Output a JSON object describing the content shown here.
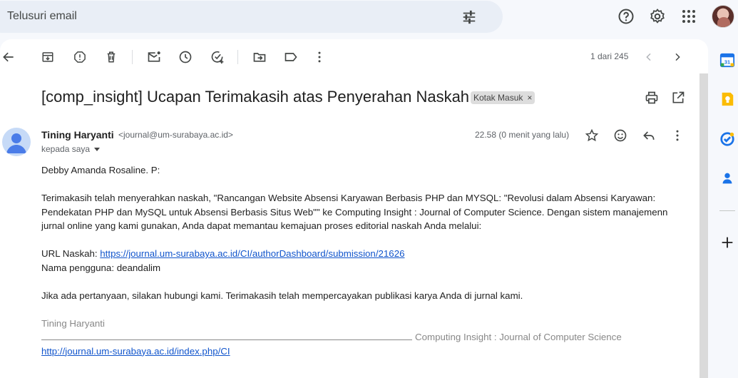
{
  "search": {
    "placeholder": "Telusuri email"
  },
  "toolbar": {
    "pager": "1 dari 245"
  },
  "message": {
    "subject": "[comp_insight] Ucapan Terimakasih atas Penyerahan Naskah",
    "label": "Kotak Masuk",
    "label_close": "×",
    "sender_name": "Tining Haryanti",
    "sender_email": "<journal@um-surabaya.ac.id>",
    "recipient": "kepada saya",
    "timestamp": "22.58 (0 menit yang lalu)",
    "greeting": "Debby Amanda Rosaline. P:",
    "para1": "Terimakasih telah menyerahkan naskah, \"Rancangan Website Absensi Karyawan Berbasis PHP dan MYSQL: \"Revolusi dalam Absensi Karyawan: Pendekatan PHP dan MySQL untuk Absensi Berbasis Situs Web\"\" ke Computing Insight : Journal of Computer Science. Dengan sistem manajemenn jurnal online yang kami gunakan, Anda dapat memantau kemajuan proses editorial naskah Anda melalui:",
    "url_label": "URL Naskah: ",
    "url": "https://journal.um-surabaya.ac.id/CI/authorDashboard/submission/21626",
    "username_line": "Nama pengguna: deandalim",
    "para2": "Jika ada pertanyaan, silakan hubungi kami. Terimakasih telah mempercayakan publikasi karya Anda di jurnal kami.",
    "signature_name": "Tining Haryanti",
    "signature_journal": "Computing Insight : Journal of Computer Science",
    "signature_link": "http://journal.um-surabaya.ac.id/index.php/CI"
  },
  "side_panel": {
    "calendar_day": "31"
  },
  "colors": {
    "accent": "#0b57d0",
    "link": "#1155cc",
    "panel_bg": "#ffffff",
    "app_bg": "#f6f8fc"
  }
}
